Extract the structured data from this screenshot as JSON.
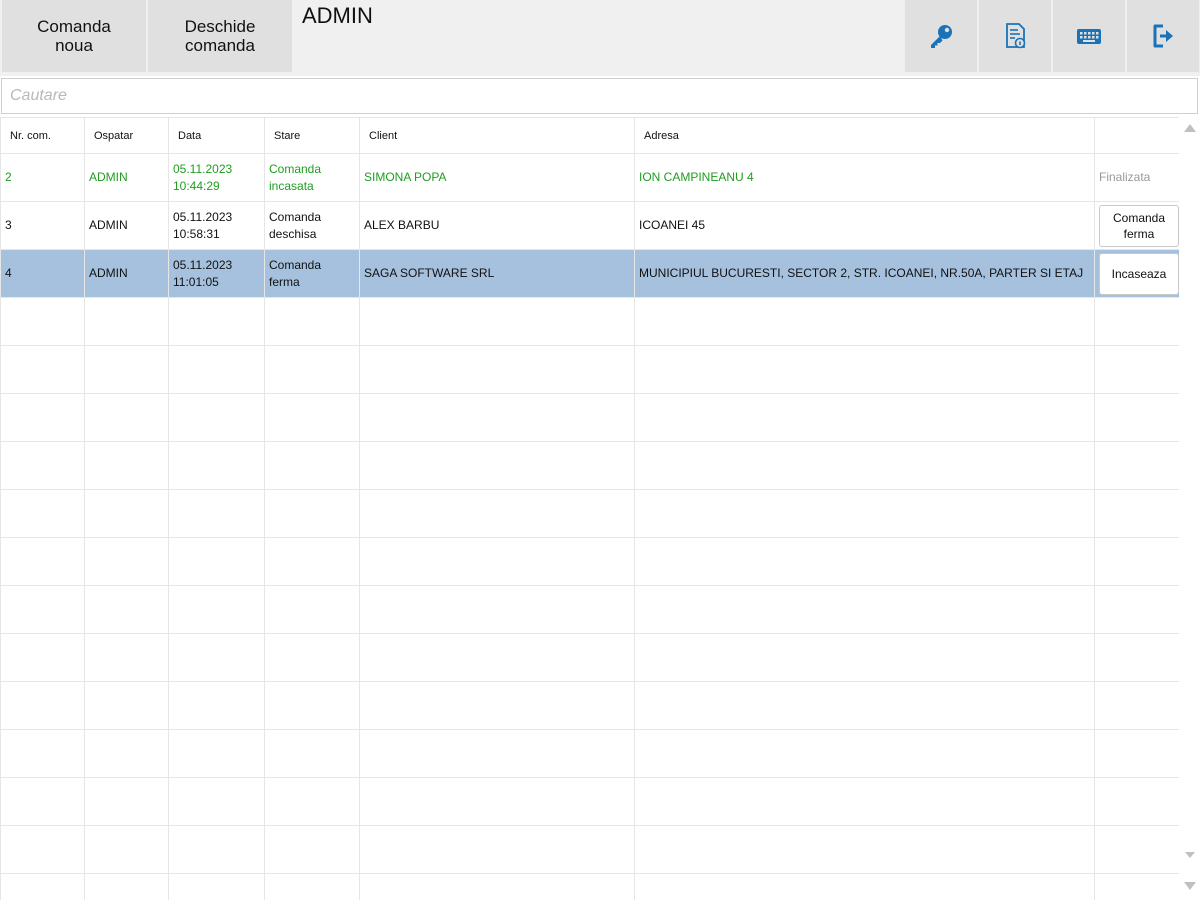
{
  "toolbar": {
    "new_order_label": "Comanda\nnoua",
    "open_order_label": "Deschide\ncomanda",
    "user": "ADMIN",
    "icons": [
      "key-icon",
      "document-info-icon",
      "keyboard-icon",
      "logout-icon"
    ],
    "icon_color": "#1a73b8"
  },
  "search": {
    "placeholder": "Cautare",
    "value": ""
  },
  "grid": {
    "columns": [
      "Nr. com.",
      "Ospatar",
      "Data",
      "Stare",
      "Client",
      "Adresa",
      ""
    ],
    "rows": [
      {
        "nr": "2",
        "ospatar": "ADMIN",
        "data": "05.11.2023\n10:44:29",
        "stare": "Comanda\nincasata",
        "client": "SIMONA POPA",
        "adresa": "ION CAMPINEANU 4",
        "action": "Finalizata",
        "status": "done",
        "status_color": "#1f9e1f"
      },
      {
        "nr": "3",
        "ospatar": "ADMIN",
        "data": "05.11.2023\n10:58:31",
        "stare": "Comanda\ndeschisa",
        "client": "ALEX BARBU",
        "adresa": "ICOANEI 45",
        "action": "Comanda\nferma",
        "status": "open"
      },
      {
        "nr": "4",
        "ospatar": "ADMIN",
        "data": "05.11.2023\n11:01:05",
        "stare": "Comanda\nferma",
        "client": "SAGA SOFTWARE SRL",
        "adresa": "MUNICIPIUL BUCURESTI, SECTOR 2, STR. ICOANEI, NR.50A, PARTER SI ETAJ",
        "action": "Incaseaza",
        "status": "firm",
        "selected": true,
        "selected_color": "#a5c1dd"
      }
    ]
  }
}
